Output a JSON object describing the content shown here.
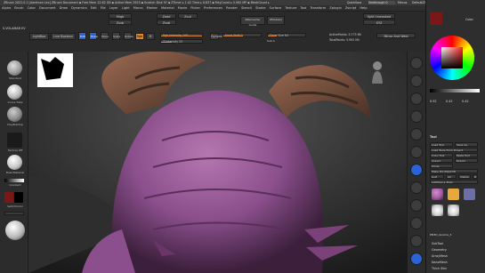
{
  "titlebar": {
    "title": "ZBrush 2022.0.1 [Aardman Lex]   ZBrush Document   ▪ Free Mem 22.62 GB ▪ Active Mem 2925 ▪ Scratch Disk 97 ▪ ZTimer ▸ 1.02 Time ▸ 0.837 ▪ PolyCount ▸ 5.992 MP ▪ MeshCount ▸ 1",
    "right_items": [
      "QuickSave",
      "Seethrough 0",
      "Menus",
      "DefaultZScript"
    ]
  },
  "menus": [
    "Alpha",
    "Brush",
    "Color",
    "Document",
    "Draw",
    "Dynamics",
    "Edit",
    "File",
    "Layer",
    "Light",
    "Macro",
    "Marker",
    "Material",
    "Movie",
    "Picker",
    "Preferences",
    "Render",
    "Stencil",
    "Stroke",
    "Surface",
    "Texture",
    "Tool",
    "Transform",
    "Zplugin",
    "Zscript",
    "Help"
  ],
  "toolbar": {
    "lightbox_label": "LightBox",
    "live_boolean": "Live Boolean",
    "edit_label": "Edit",
    "draw_label": "Draw",
    "move_label": "Move",
    "scale_label": "Scale",
    "rotate_label": "Rotate",
    "mrgb": "Mrgb",
    "rgb": "Rgb",
    "m_label": "M",
    "zadd": "Zadd",
    "zsub": "Zsub",
    "zcut": "Zcut",
    "rgb_intensity": "Rgb Intensity 100",
    "z_intensity": "Z Intensity 25",
    "focal_shift": "Focal Shift 0",
    "draw_size": "Draw Size 64",
    "dynamic": "Dynamic",
    "active_points": "ActivePoints: 5.775 Mil",
    "total_points": "TotalPoints: 5.992 Mil",
    "mirror": "Mirror And Weld",
    "xyz": "XYZ",
    "split_unmasked": "Split Unmasked Points",
    "ztool_label": "ZRemesher Guide",
    "zmodeler": "ZModeler",
    "sub": "Sub 0"
  },
  "palette": {
    "spotlight": "S.VOLAMAR EV",
    "brushes": [
      {
        "name": "Standard",
        "color": "#9a9a9a"
      },
      {
        "name": "Curve Tube",
        "color": "#b8b8b8"
      },
      {
        "name": "ClayBuildup",
        "color": "#8a8a8a"
      },
      {
        "name": "Texture Off",
        "color": "#444444"
      },
      {
        "name": "BasicMaterial",
        "color": "#c8c8c8"
      }
    ],
    "gradient": "Gradient",
    "switch_color": "SwitchColor",
    "alternate": "Alternate"
  },
  "canvas": {
    "skin_color": "#8a4f8c",
    "horn_color": "#6b4a3a",
    "floor_color": "#3b3b3b"
  },
  "right_tray": {
    "color_label": "Color",
    "tool_label": "Tool",
    "rgb_values": [
      "0.92",
      "0.42",
      "0.42"
    ],
    "items": [
      "Load Tool",
      "Save As",
      "Load Tools From Project",
      "Copy Tool",
      "Paste Tool",
      "Import",
      "Export",
      "Clone",
      "Make PolyMesh3D",
      "GoZ",
      "All",
      "Visible",
      "R",
      "Lightbox ▸ Tools",
      "PM3D_Gnome_3"
    ],
    "subtools": [
      "SubTool",
      "Geometry",
      "ArrayMesh",
      "NanoMesh",
      "Thick Skin"
    ],
    "thumbs": [
      {
        "name": "PM3D_Gnome",
        "color": "#a35aa0"
      },
      {
        "name": "Cylinder3D",
        "color": "#e9a83b"
      },
      {
        "name": "PolyMesh3D",
        "color": "#6f6fa8"
      },
      {
        "name": "SimpleBrush",
        "color": "#cfcfcf"
      },
      {
        "name": "Sphere3D",
        "color": "#cfcfcf"
      },
      {
        "name": "Gnome",
        "color": "#a35aa0"
      }
    ]
  },
  "colors": {
    "accent": "#e08a2b",
    "active": "#2a63d6",
    "main_color": "#7a1818",
    "secondary_color": "#000000"
  }
}
